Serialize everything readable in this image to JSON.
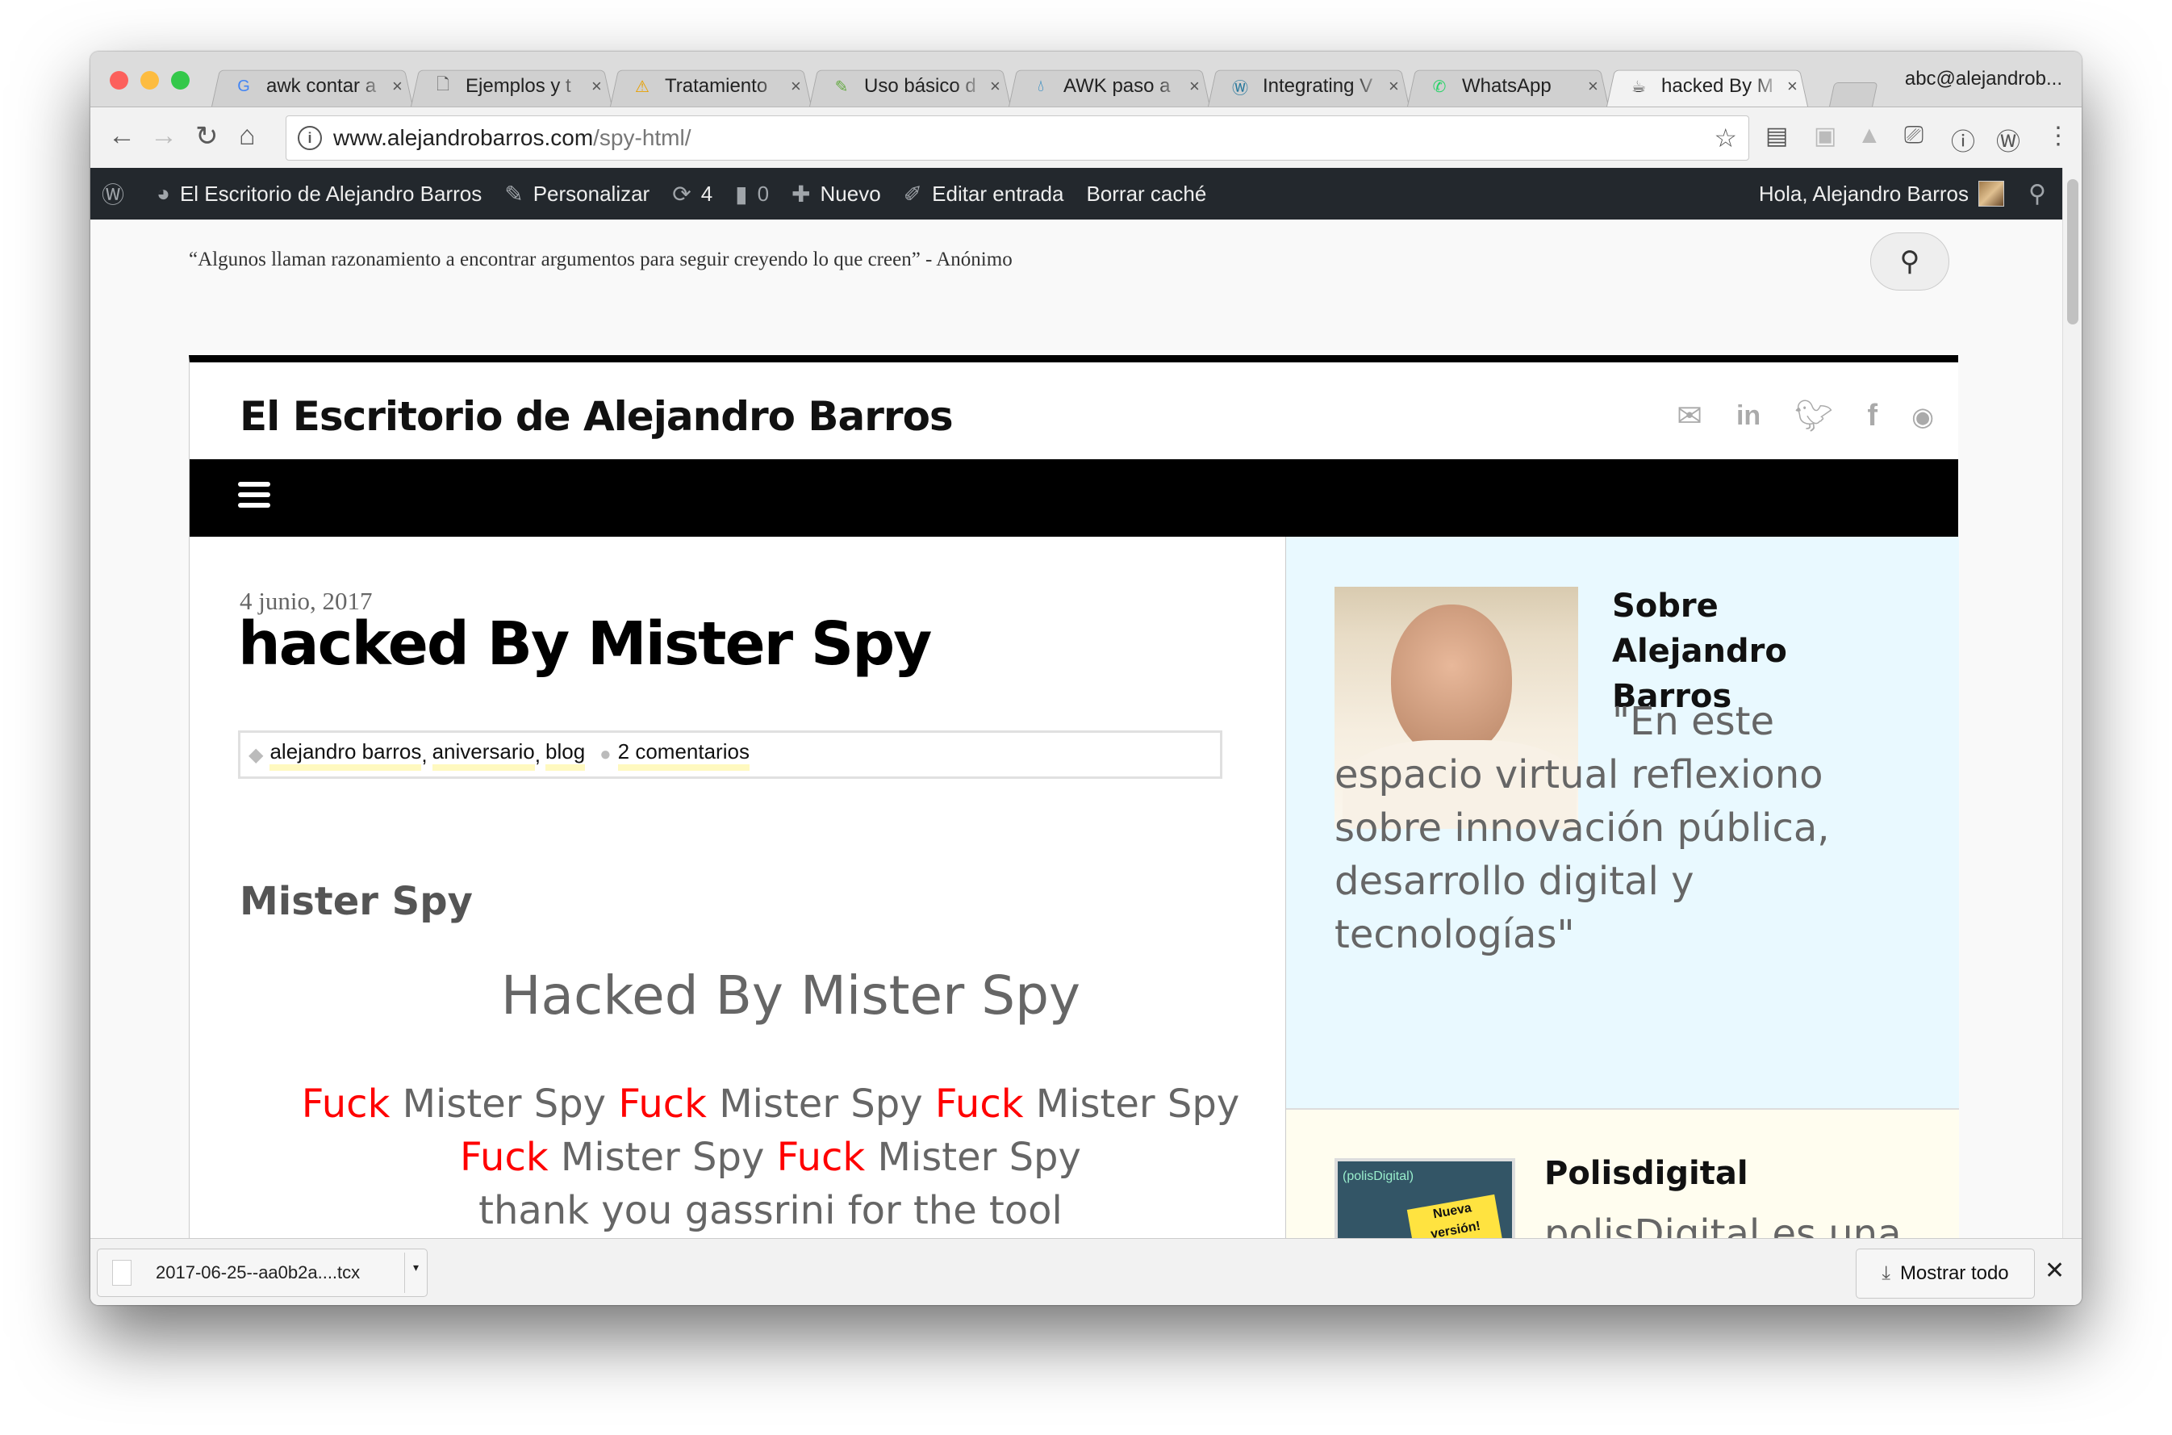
{
  "browser": {
    "tabs": [
      {
        "title": "awk contar a",
        "icon": "google-icon",
        "active": false
      },
      {
        "title": "Ejemplos y t",
        "icon": "document-icon",
        "active": false
      },
      {
        "title": "Tratamiento",
        "icon": "warning-icon",
        "active": false
      },
      {
        "title": "Uso básico d",
        "icon": "notepad-icon",
        "active": false
      },
      {
        "title": "AWK paso a",
        "icon": "drupal-icon",
        "active": false
      },
      {
        "title": "Integrating V",
        "icon": "wordpress-icon",
        "active": false
      },
      {
        "title": "WhatsApp",
        "icon": "whatsapp-icon",
        "active": false
      },
      {
        "title": "hacked By M",
        "icon": "polisdigital-icon",
        "active": true
      }
    ],
    "tab_close": "×",
    "profile": "abc@alejandrob...",
    "url_host": "www.alejandrobarros.com",
    "url_path": "/spy-html/"
  },
  "adminbar": {
    "site_name": "El Escritorio de Alejandro Barros",
    "customize": "Personalizar",
    "updates_count": "4",
    "comments_count": "0",
    "new": "Nuevo",
    "edit": "Editar entrada",
    "clear_cache": "Borrar caché",
    "greeting": "Hola, Alejandro Barros"
  },
  "page": {
    "quote": "“Algunos llaman razonamiento a encontrar argumentos para seguir creyendo lo que creen” - Anónimo",
    "site_title": "El Escritorio de Alejandro Barros",
    "post": {
      "date": "4 junio, 2017",
      "title": "hacked By Mister Spy",
      "tags": [
        "alejandro barros",
        "aniversario",
        "blog"
      ],
      "comments": "2 comentarios",
      "heading": "Mister Spy",
      "hacked_line": "Hacked By Mister Spy",
      "red_word": "Fuck",
      "gray_phrase": "Mister Spy",
      "thanks": "thank you gassrini for the tool"
    },
    "sidebar": {
      "about_title": "Sobre Alejandro Barros",
      "about_text": "\"En este espacio virtual reflexiono sobre innovación pública, desarrollo digital y tecnologías\"",
      "polis_title": "Polisdigital",
      "polis_text": "polisDigital es una",
      "polis_img_label": "(polisDigital)",
      "polis_img_note": "Nueva versión!"
    }
  },
  "downloads": {
    "file": "2017-06-25--aa0b2a....tcx",
    "show_all": "Mostrar todo"
  }
}
